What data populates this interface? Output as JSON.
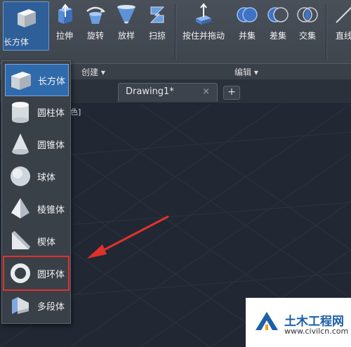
{
  "ribbon": {
    "buttons": [
      {
        "label": "长方体",
        "icon": "box-icon"
      },
      {
        "label": "拉伸",
        "icon": "extrude-icon"
      },
      {
        "label": "旋转",
        "icon": "revolve-icon"
      },
      {
        "label": "放样",
        "icon": "loft-icon"
      },
      {
        "label": "扫掠",
        "icon": "sweep-icon"
      },
      {
        "label": "按住并拖动",
        "icon": "presspull-icon"
      },
      {
        "label": "并集",
        "icon": "union-icon"
      },
      {
        "label": "差集",
        "icon": "subtract-icon"
      },
      {
        "label": "交集",
        "icon": "intersect-icon"
      },
      {
        "label": "直线",
        "icon": "line-icon"
      }
    ],
    "groups": {
      "create": "创建 ▾",
      "edit": "编辑 ▾"
    }
  },
  "tabs": {
    "active_title": "Drawing1*",
    "close_symbol": "×",
    "add_symbol": "+"
  },
  "viewport": {
    "partial_label": "色]"
  },
  "dropdown": {
    "items": [
      {
        "label": "长方体",
        "icon": "box-icon"
      },
      {
        "label": "圆柱体",
        "icon": "cylinder-icon"
      },
      {
        "label": "圆锥体",
        "icon": "cone-icon"
      },
      {
        "label": "球体",
        "icon": "sphere-icon"
      },
      {
        "label": "棱锥体",
        "icon": "pyramid-icon"
      },
      {
        "label": "楔体",
        "icon": "wedge-icon"
      },
      {
        "label": "圆环体",
        "icon": "torus-icon"
      },
      {
        "label": "多段体",
        "icon": "polysolid-icon"
      }
    ],
    "active_index": 0,
    "highlighted_index": 6
  },
  "watermark": {
    "title": "土木工程网",
    "url": "www.civilcn.com"
  },
  "colors": {
    "annotation": "#e0312d",
    "accent": "#2f6aab"
  }
}
